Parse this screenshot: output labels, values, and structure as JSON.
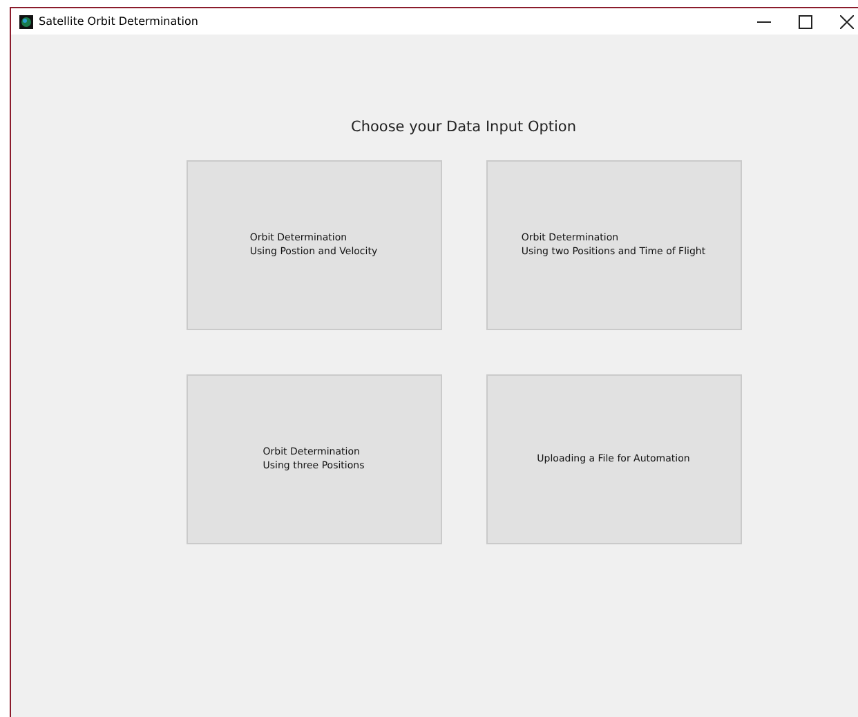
{
  "window": {
    "title": "Satellite Orbit Determination"
  },
  "heading": "Choose your Data Input Option",
  "options": [
    {
      "label": "Orbit Determination\nUsing Postion and Velocity"
    },
    {
      "label": "Orbit Determination\nUsing two Positions and Time of Flight"
    },
    {
      "label": "Orbit Determination\nUsing three Positions"
    },
    {
      "label": "Uploading a File for Automation"
    }
  ]
}
